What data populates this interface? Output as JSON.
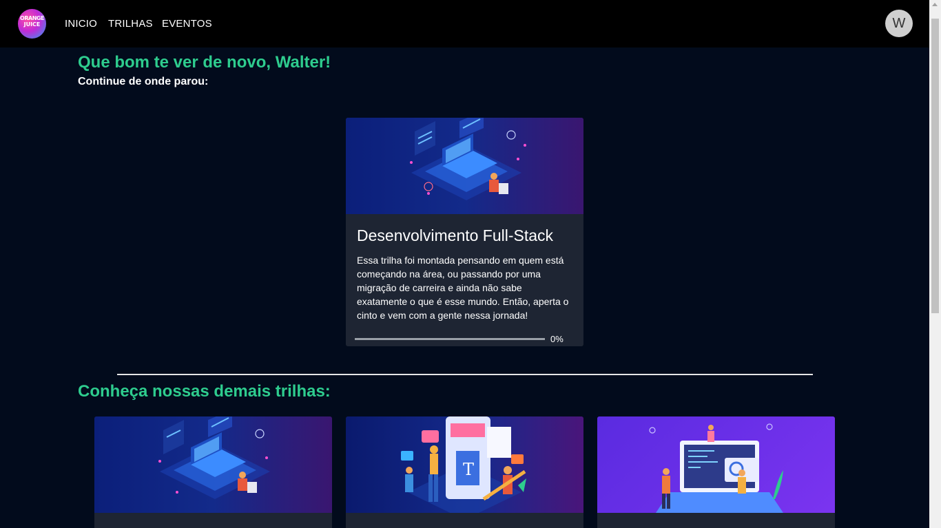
{
  "header": {
    "logo_text_line1": "ORANGE",
    "logo_text_line2": "JUICE",
    "nav": [
      "INICIO",
      "TRILHAS",
      "EVENTOS"
    ],
    "avatar_initial": "W"
  },
  "main": {
    "greeting": "Que bom te ver de novo, Walter!",
    "continue_label": "Continue de onde parou:",
    "current_track": {
      "title": "Desenvolvimento Full-Stack",
      "description": "Essa trilha foi montada pensando em quem está começando na área, ou passando por uma migração de carreira e ainda não sabe exatamente o que é esse mundo. Então, aperta o cinto e vem com a gente nessa jornada!",
      "progress_value": 0,
      "progress_label": "0%"
    },
    "other_tracks_title": "Conheça nossas demais trilhas:",
    "other_tracks": [
      {
        "image": "full-stack-illustration"
      },
      {
        "image": "ux-ui-design-illustration"
      },
      {
        "image": "web-development-illustration"
      }
    ]
  },
  "colors": {
    "accent": "#2ecc8e",
    "background": "#020b1c",
    "card": "#1e2533",
    "topbar": "#000000"
  }
}
